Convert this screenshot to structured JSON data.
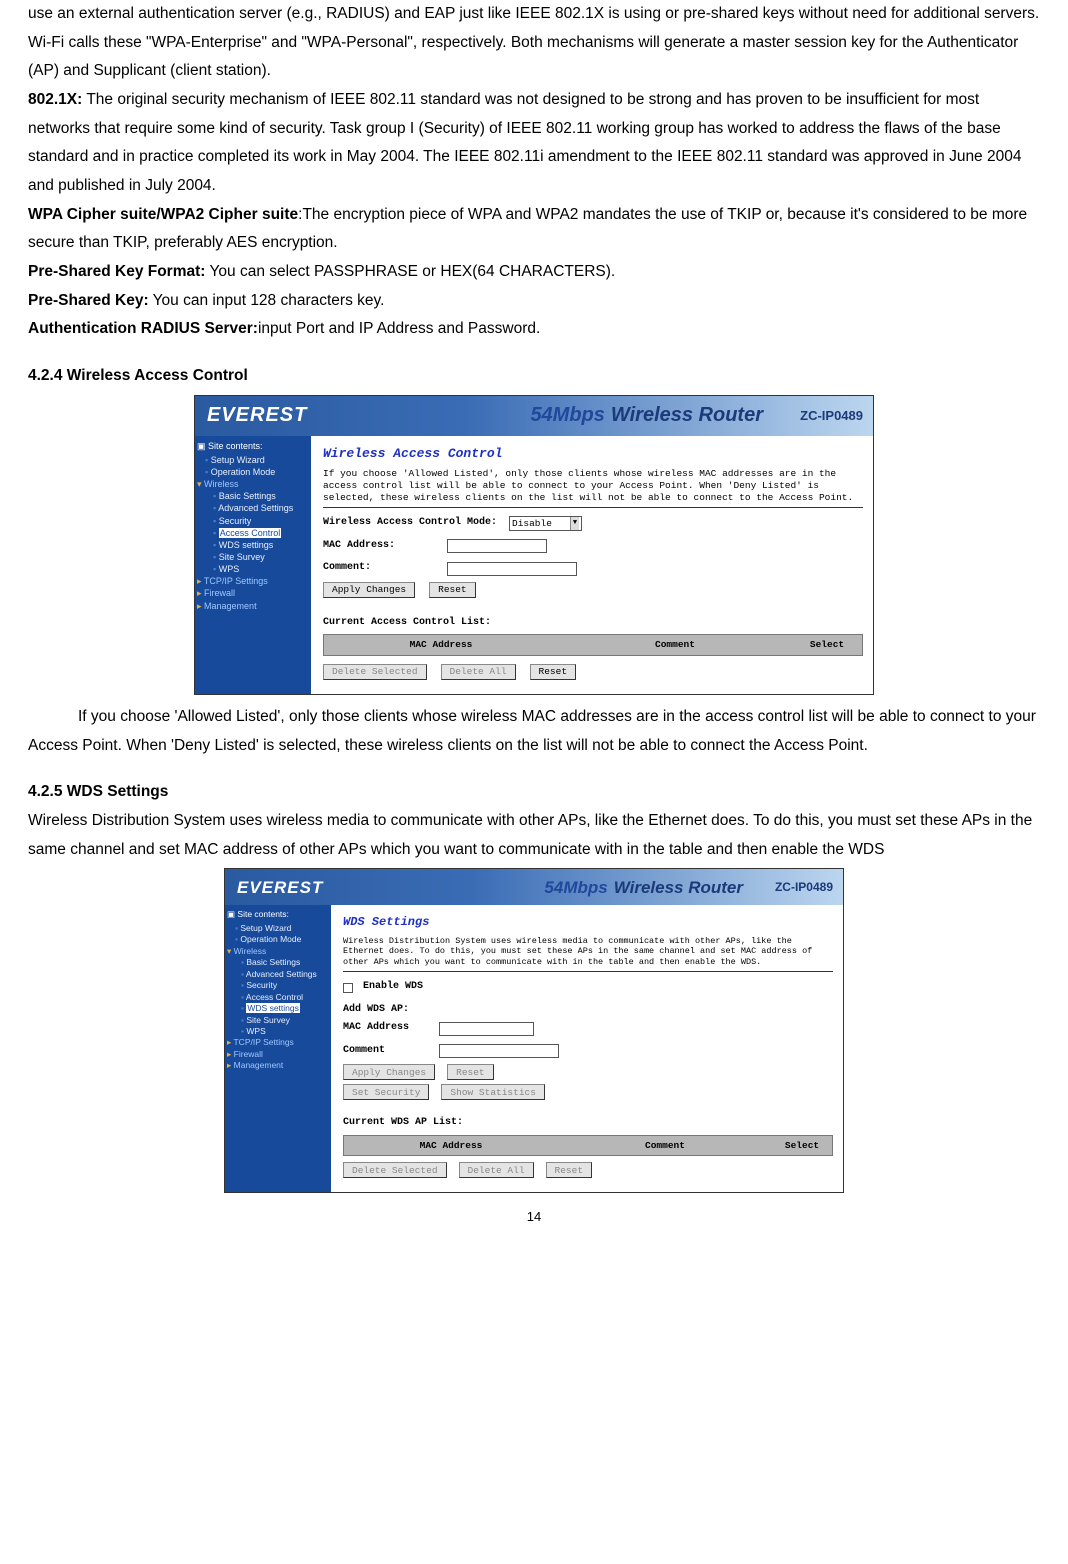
{
  "intro": {
    "p1": "use an external authentication server (e.g., RADIUS) and EAP just like IEEE 802.1X is using or pre-shared keys without need for additional servers. Wi-Fi calls these \"WPA-Enterprise\" and \"WPA-Personal\", respectively. Both mechanisms will generate a master session key for the Authenticator (AP) and Supplicant (client station).",
    "l_8021x": "802.1X:",
    "p2": " The original security mechanism of IEEE 802.11 standard was not designed to be strong and has proven to be insufficient for most networks that require some kind of security. Task group I (Security) of IEEE 802.11 working group has worked to address the flaws of the base standard and in practice completed its work in May 2004. The IEEE 802.11i amendment to the IEEE 802.11 standard was approved in June 2004 and published in July 2004.",
    "l_cipher": "WPA Cipher suite/WPA2 Cipher suite",
    "p_cipher": ":The encryption piece of WPA and WPA2 mandates the use of TKIP or, because it's considered to be more secure than TKIP, preferably AES encryption.",
    "l_pskf": "Pre-Shared Key Format:",
    "p_pskf": " You can select  PASSPHRASE or HEX(64 CHARACTERS).",
    "l_psk": "Pre-Shared Key:",
    "p_psk": " You can input 128 characters key.",
    "l_radius": "Authentication RADIUS Server:",
    "p_radius": "input Port and IP Address and Password."
  },
  "sec424": {
    "heading": "4.2.4 Wireless Access Control",
    "para": "If you choose 'Allowed Listed', only those clients whose wireless MAC addresses are in the access control list will be able to connect to your Access Point. When 'Deny Listed' is selected, these wireless clients on the list will not be able to connect the Access Point."
  },
  "sec425": {
    "heading": "4.2.5 WDS Settings",
    "para": "Wireless Distribution System uses wireless media to communicate with other APs, like the Ethernet does. To do this, you must set these APs in the same channel and set MAC address of other APs which you want to communicate with in the table and then enable the WDS"
  },
  "router": {
    "logo": "EVEREST",
    "tagline_54": "54Mbps",
    "tagline_rest": "Wireless Router",
    "model": "ZC-IP0489",
    "nav": {
      "contents": "Site contents:",
      "setup": "Setup Wizard",
      "opmode": "Operation Mode",
      "wireless": "Wireless",
      "basic": "Basic Settings",
      "advanced": "Advanced Settings",
      "security": "Security",
      "access": "Access Control",
      "wds": "WDS settings",
      "survey": "Site Survey",
      "wps": "WPS",
      "tcpip": "TCP/IP Settings",
      "firewall": "Firewall",
      "mgmt": "Management"
    },
    "wac": {
      "title": "Wireless Access Control",
      "desc": "If you choose 'Allowed Listed', only those clients whose wireless MAC addresses are in the access control list will be able to connect to your Access Point. When 'Deny Listed' is selected, these wireless clients on the list will not be able to connect to the Access Point.",
      "mode_label": "Wireless Access Control Mode:",
      "mode_value": "Disable",
      "mac_label": "MAC Address:",
      "comment_label": "Comment:",
      "apply": "Apply Changes",
      "reset": "Reset",
      "list_label": "Current Access Control List:",
      "col_mac": "MAC Address",
      "col_comment": "Comment",
      "col_select": "Select",
      "del_sel": "Delete Selected",
      "del_all": "Delete All",
      "reset2": "Reset"
    },
    "wds": {
      "title": "WDS Settings",
      "desc": "Wireless Distribution System uses wireless media to communicate with other APs, like the Ethernet does. To do this, you must set these APs in the same channel and set MAC address of other APs which you want to communicate with in the table and then enable the WDS.",
      "enable": "Enable WDS",
      "add": "Add WDS AP:",
      "mac_label": "MAC Address",
      "comment_label": "Comment",
      "apply": "Apply Changes",
      "reset": "Reset",
      "setsec": "Set Security",
      "showstat": "Show Statistics",
      "list_label": "Current WDS AP List:",
      "col_mac": "MAC Address",
      "col_comment": "Comment",
      "col_select": "Select",
      "del_sel": "Delete Selected",
      "del_all": "Delete All",
      "reset2": "Reset"
    }
  },
  "page_number": "14"
}
